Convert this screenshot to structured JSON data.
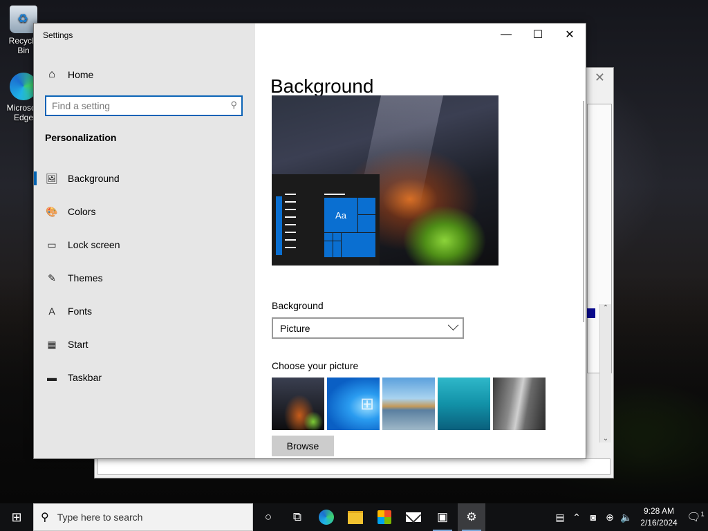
{
  "desktop": {
    "icons": [
      {
        "label": "Recycle Bin",
        "icon": "recycle-bin-icon"
      },
      {
        "label": "Microsoft Edge",
        "icon": "edge-icon"
      }
    ]
  },
  "settings": {
    "title": "Settings",
    "caption": {
      "minimize": "—",
      "maximize": "☐",
      "close": "✕"
    },
    "home_label": "Home",
    "search_placeholder": "Find a setting",
    "section": "Personalization",
    "nav": [
      {
        "label": "Background",
        "icon": "picture-icon",
        "glyph": "🖼",
        "active": true
      },
      {
        "label": "Colors",
        "icon": "palette-icon",
        "glyph": "🎨"
      },
      {
        "label": "Lock screen",
        "icon": "lock-screen-icon",
        "glyph": "▭"
      },
      {
        "label": "Themes",
        "icon": "themes-icon",
        "glyph": "✎"
      },
      {
        "label": "Fonts",
        "icon": "fonts-icon",
        "glyph": "A"
      },
      {
        "label": "Start",
        "icon": "start-icon",
        "glyph": "▦"
      },
      {
        "label": "Taskbar",
        "icon": "taskbar-icon",
        "glyph": "▬"
      }
    ],
    "page_title": "Background",
    "preview_tile_label": "Aa",
    "background_label": "Background",
    "background_value": "Picture",
    "choose_label": "Choose your picture",
    "thumbnails": [
      "night-sky-tent",
      "windows-blue",
      "beach-rocks",
      "underwater-swimmer",
      "rock-cliff"
    ],
    "browse_label": "Browse"
  },
  "taskbar": {
    "search_placeholder": "Type here to search",
    "apps": [
      "cortana-icon",
      "task-view-icon",
      "edge-icon",
      "file-explorer-icon",
      "store-icon",
      "mail-icon",
      "package-icon",
      "settings-icon"
    ],
    "time": "9:28 AM",
    "date": "2/16/2024",
    "notification_count": "1"
  }
}
